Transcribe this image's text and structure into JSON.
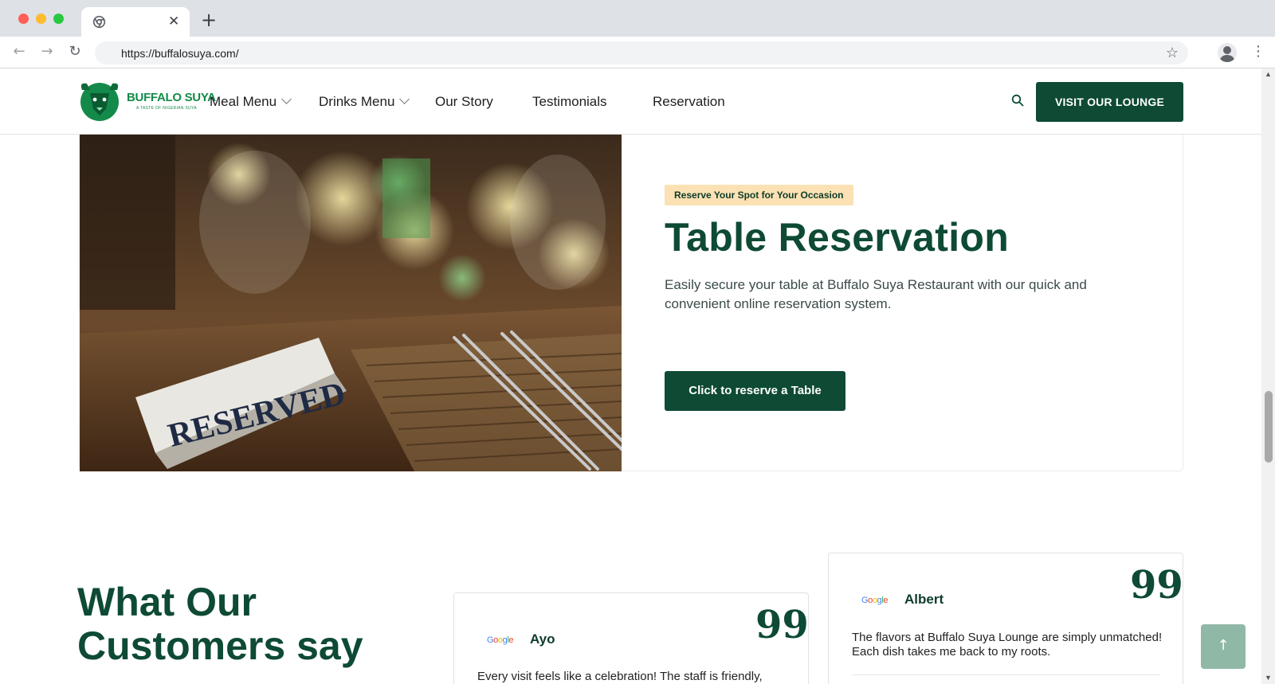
{
  "browser": {
    "url": "https://buffalosuya.com/",
    "tab_close": "✕",
    "new_tab": "+"
  },
  "header": {
    "logo_text": "BUFFALO SUYA",
    "logo_subtext": "A TASTE OF NIGERIAN SUYA",
    "nav": [
      {
        "label": "Meal Menu",
        "has_dropdown": true
      },
      {
        "label": "Drinks Menu",
        "has_dropdown": true
      },
      {
        "label": "Our Story",
        "has_dropdown": false
      },
      {
        "label": "Testimonials",
        "has_dropdown": false
      },
      {
        "label": "Reservation",
        "has_dropdown": false
      }
    ],
    "cta_label": "VISIT OUR LOUNGE"
  },
  "reservation": {
    "badge": "Reserve Your Spot for Your Occasion",
    "title": "Table Reservation",
    "description": "Easily secure your table at Buffalo Suya Restaurant with our quick and convenient online reservation system.",
    "button_label": "Click to reserve a Table",
    "image_sign_text": "RESERVED"
  },
  "testimonials": {
    "heading": "What Our Customers say",
    "cards": [
      {
        "source": "Google",
        "name": "Ayo",
        "text": "Every visit feels like a celebration! The staff is friendly,"
      },
      {
        "source": "Google",
        "name": "Albert",
        "text": "The flavors at Buffalo Suya Lounge are simply unmatched! Each dish takes me back to my roots."
      }
    ],
    "quote_glyph": "99"
  },
  "colors": {
    "brand_green": "#0e4a34",
    "logo_green": "#138a4a",
    "badge_bg": "#fbe1b3",
    "to_top_bg": "#8fb8a7"
  },
  "to_top_arrow": "↑"
}
